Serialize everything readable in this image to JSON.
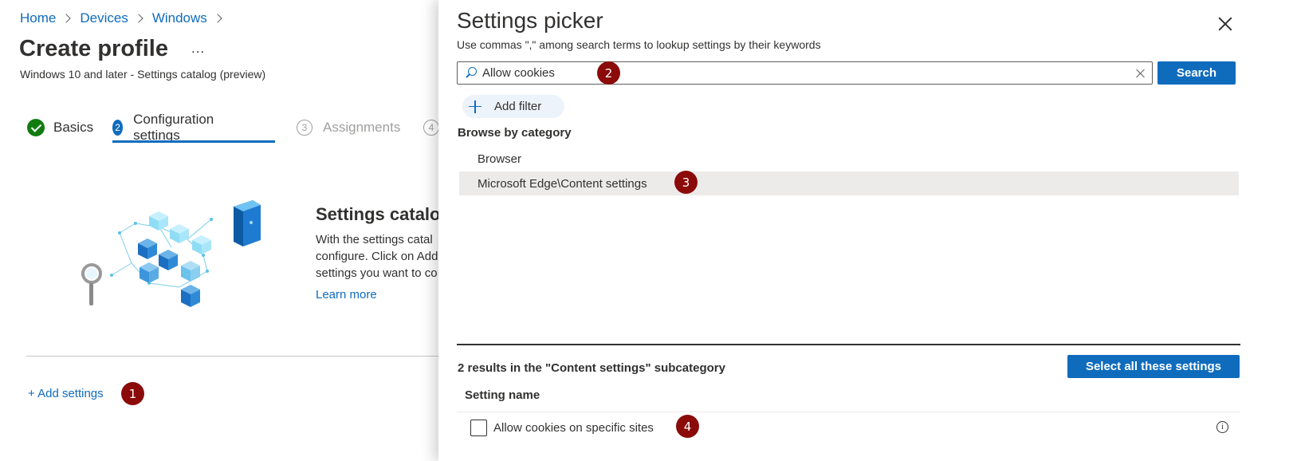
{
  "breadcrumb": [
    {
      "label": "Home"
    },
    {
      "label": "Devices"
    },
    {
      "label": "Windows"
    }
  ],
  "page": {
    "title": "Create profile",
    "more": "...",
    "subtitle": "Windows 10 and later - Settings catalog (preview)"
  },
  "steps": [
    {
      "number": "",
      "label": "Basics",
      "state": "complete"
    },
    {
      "number": "2",
      "label": "Configuration settings",
      "state": "active"
    },
    {
      "number": "3",
      "label": "Assignments",
      "state": "inactive"
    },
    {
      "number": "4",
      "label": "",
      "state": "inactive"
    }
  ],
  "catalog": {
    "title": "Settings catalog",
    "description_lines": [
      "With the settings catal",
      "configure. Click on Add",
      "settings you want to co"
    ],
    "learn_more": "Learn more"
  },
  "add_settings": "+ Add settings",
  "panel": {
    "title": "Settings picker",
    "subtitle": "Use commas \",\" among search terms to lookup settings by their keywords",
    "search": {
      "value": "Allow cookies",
      "button": "Search"
    },
    "add_filter": "Add filter",
    "browse_label": "Browse by category",
    "categories": [
      {
        "label": "Browser",
        "selected": false
      },
      {
        "label": "Microsoft Edge\\Content settings",
        "selected": true
      }
    ],
    "results_text": "2 results in the \"Content settings\" subcategory",
    "select_all": "Select all these settings",
    "column_header": "Setting name",
    "rows": [
      {
        "name": "Allow cookies on specific sites",
        "checked": false
      }
    ]
  },
  "badges": [
    "1",
    "2",
    "3",
    "4"
  ],
  "icons": {
    "info": "i"
  },
  "colors": {
    "accent": "#0f6cbd",
    "badge": "#8b0a0a",
    "success": "#107c10",
    "selected_row": "#edebe9"
  }
}
